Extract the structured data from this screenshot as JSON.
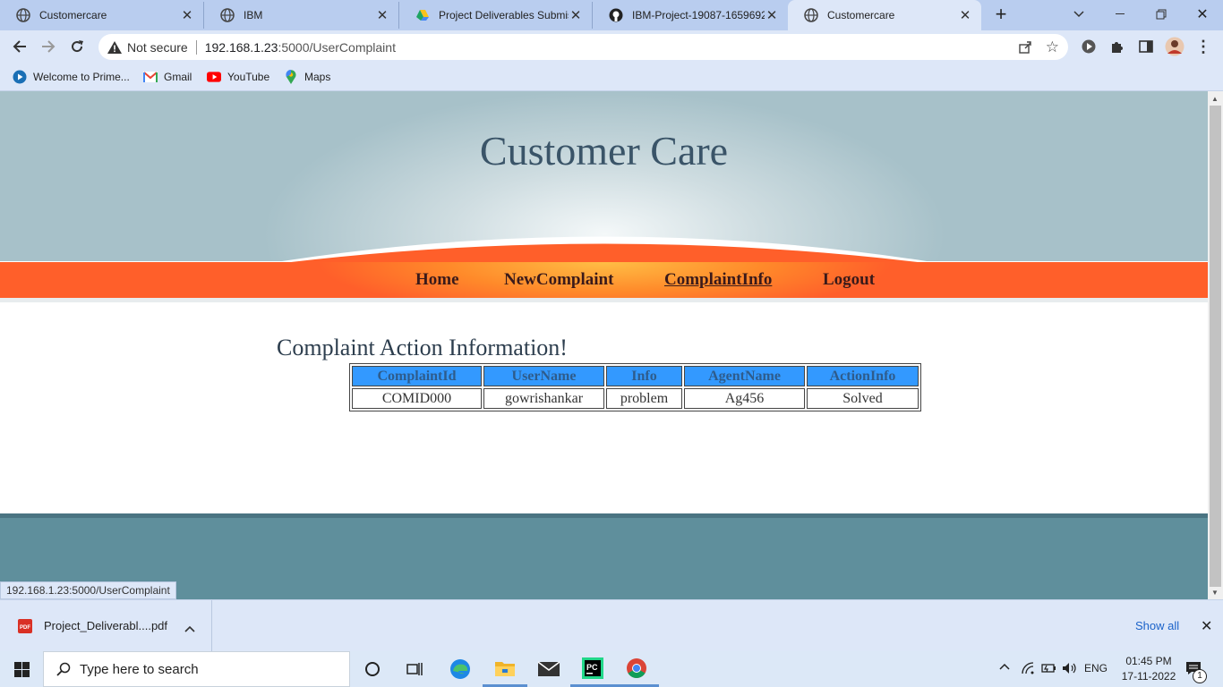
{
  "browser": {
    "tabs": [
      {
        "title": "Customercare",
        "active": false
      },
      {
        "title": "IBM",
        "active": false
      },
      {
        "title": "Project Deliverables Submissi",
        "active": false
      },
      {
        "title": "IBM-Project-19087-1659692",
        "active": false
      },
      {
        "title": "Customercare",
        "active": true
      }
    ],
    "security_label": "Not secure",
    "url_host": "192.168.1.23",
    "url_path": ":5000/UserComplaint",
    "bookmarks": [
      "Welcome to Prime...",
      "Gmail",
      "YouTube",
      "Maps"
    ]
  },
  "site": {
    "title": "Customer Care",
    "nav": [
      {
        "label": "Home",
        "current": false
      },
      {
        "label": "NewComplaint",
        "current": false
      },
      {
        "label": "ComplaintInfo",
        "current": true
      },
      {
        "label": "Logout",
        "current": false
      }
    ],
    "content_title": "Complaint Action Information!",
    "table": {
      "headers": [
        "ComplaintId",
        "UserName",
        "Info",
        "AgentName",
        "ActionInfo"
      ],
      "rows": [
        [
          "COMID000",
          "gowrishankar",
          "problem",
          "Ag456",
          "Solved"
        ]
      ]
    },
    "status_url": "192.168.1.23:5000/UserComplaint"
  },
  "downloads": {
    "file_name": "Project_Deliverabl....pdf",
    "show_all": "Show all"
  },
  "taskbar": {
    "search_placeholder": "Type here to search",
    "lang": "ENG",
    "time": "01:45 PM",
    "date": "17-11-2022",
    "notification_count": "1"
  },
  "colors": {
    "nav_orange": "#ff5f2a",
    "table_header": "#3399ff",
    "footer": "#5f8f9c"
  }
}
